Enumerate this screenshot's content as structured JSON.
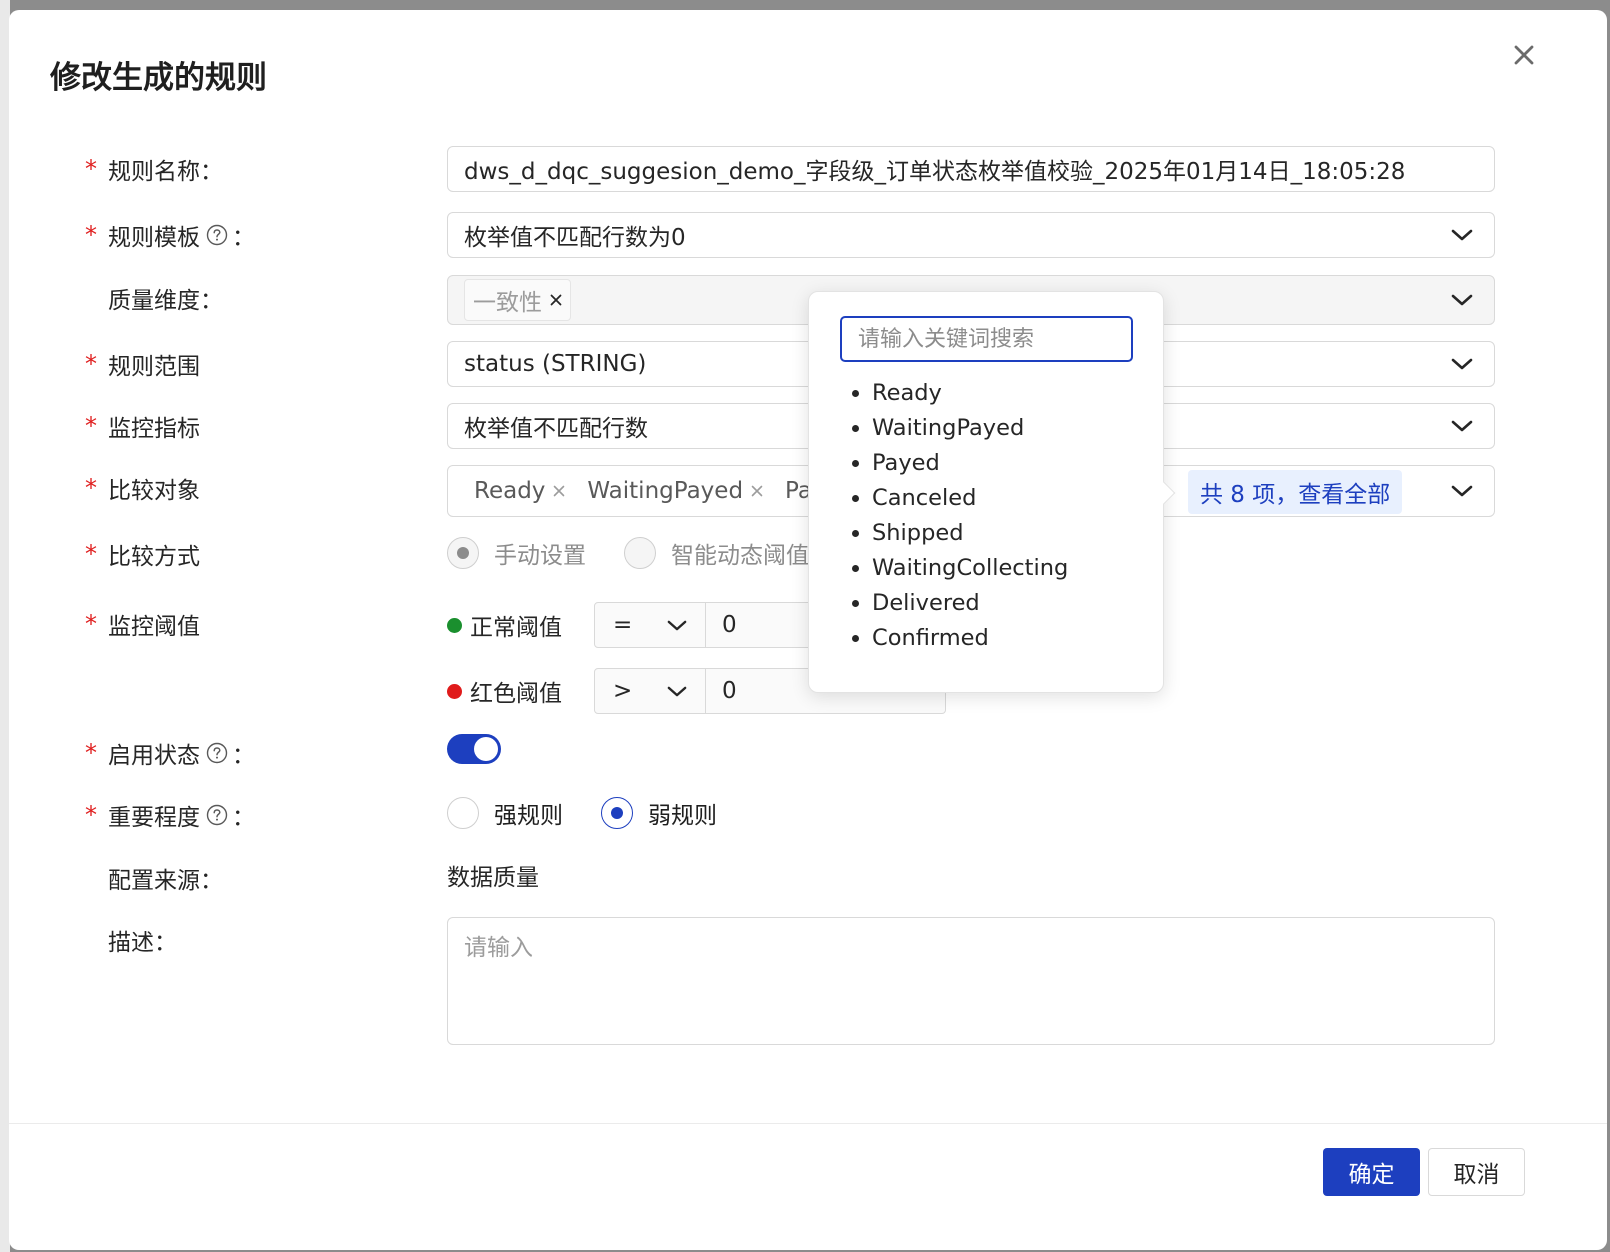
{
  "dialog": {
    "title": "修改生成的规则",
    "confirm_label": "确定",
    "cancel_label": "取消"
  },
  "fields": {
    "rule_name": {
      "label": "规则名称：",
      "value": "dws_d_dqc_suggesion_demo_字段级_订单状态枚举值校验_2025年01月14日_18:05:28"
    },
    "rule_template": {
      "label": "规则模板",
      "colon": "：",
      "value": "枚举值不匹配行数为0"
    },
    "quality_dimension": {
      "label": "质量维度：",
      "tag": "一致性"
    },
    "rule_scope": {
      "label": "规则范围",
      "value": "status (STRING)"
    },
    "monitor_metric": {
      "label": "监控指标",
      "value": "枚举值不匹配行数"
    },
    "compare_object": {
      "label": "比较对象",
      "tags": [
        "Ready",
        "WaitingPayed",
        "Pa"
      ],
      "more_text": "共 8 项，查看全部"
    },
    "compare_method": {
      "label": "比较方式",
      "options": [
        "手动设置",
        "智能动态阈值"
      ],
      "selected": "手动设置"
    },
    "monitor_threshold": {
      "label": "监控阈值",
      "normal": {
        "label": "正常阈值",
        "operator": "=",
        "value": "0",
        "color": "#1a8f2e"
      },
      "red": {
        "label": "红色阈值",
        "operator": ">",
        "value": "0",
        "color": "#e01b1b"
      }
    },
    "enable_status": {
      "label": "启用状态",
      "colon": "：",
      "enabled": true
    },
    "importance": {
      "label": "重要程度",
      "colon": "：",
      "options": [
        "强规则",
        "弱规则"
      ],
      "selected": "弱规则"
    },
    "config_source": {
      "label": "配置来源：",
      "value": "数据质量"
    },
    "description": {
      "label": "描述：",
      "placeholder": "请输入"
    }
  },
  "popover": {
    "search_placeholder": "请输入关键词搜索",
    "items": [
      "Ready",
      "WaitingPayed",
      "Payed",
      "Canceled",
      "Shipped",
      "WaitingCollecting",
      "Delivered",
      "Confirmed"
    ]
  },
  "colors": {
    "primary": "#1d3fbf",
    "required": "#e02020",
    "border": "#d9d9d9"
  }
}
